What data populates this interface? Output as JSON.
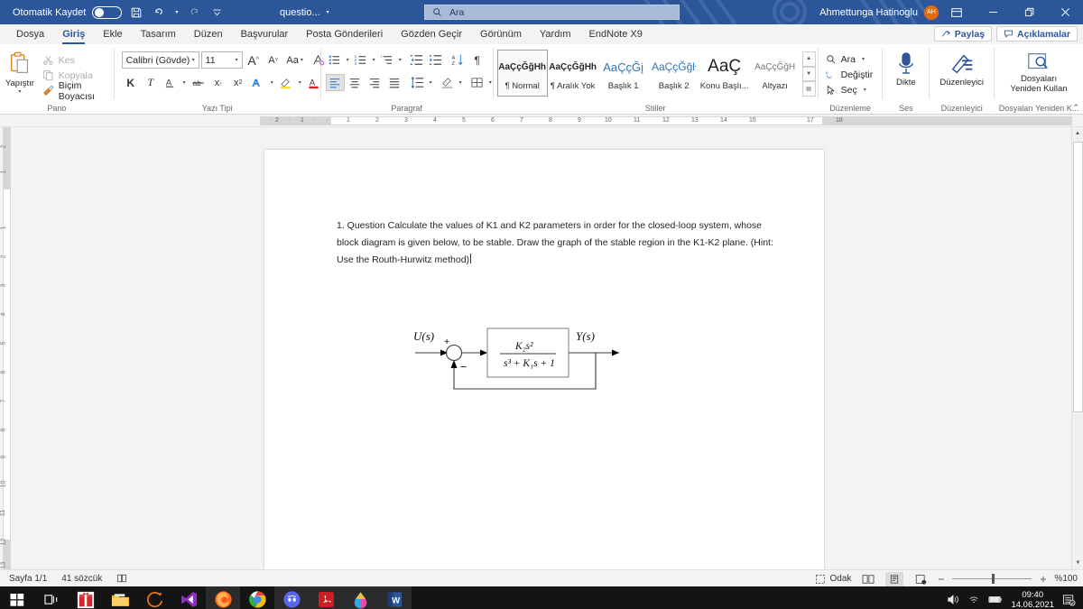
{
  "titlebar": {
    "autosave_label": "Otomatik Kaydet",
    "autosave_state": "off",
    "save_icon": "save-icon",
    "undo_icon": "undo-icon",
    "redo_icon": "redo-icon",
    "customize_icon": "customize-quick-access-icon",
    "document_name": "questio...",
    "search_placeholder": "Ara",
    "search_icon": "search-icon",
    "user_name": "Ahmettunga Hatinoglu",
    "user_initials": "AH",
    "ribbon_display_icon": "ribbon-display-options-icon",
    "minimize_icon": "minimize-icon",
    "restore_icon": "restore-icon",
    "close_icon": "close-icon"
  },
  "tabs": [
    {
      "label": "Dosya",
      "active": false
    },
    {
      "label": "Giriş",
      "active": true
    },
    {
      "label": "Ekle",
      "active": false
    },
    {
      "label": "Tasarım",
      "active": false
    },
    {
      "label": "Düzen",
      "active": false
    },
    {
      "label": "Başvurular",
      "active": false
    },
    {
      "label": "Posta Gönderileri",
      "active": false
    },
    {
      "label": "Gözden Geçir",
      "active": false
    },
    {
      "label": "Görünüm",
      "active": false
    },
    {
      "label": "Yardım",
      "active": false
    },
    {
      "label": "EndNote X9",
      "active": false
    }
  ],
  "tabstrip_right": {
    "share_label": "Paylaş",
    "share_icon": "share-icon",
    "comments_label": "Açıklamalar",
    "comments_icon": "comment-icon"
  },
  "ribbon": {
    "clipboard": {
      "group_label": "Pano",
      "paste_label": "Yapıştır",
      "paste_icon": "paste-icon",
      "cut_label": "Kes",
      "cut_icon": "scissors-icon",
      "copy_label": "Kopyala",
      "copy_icon": "copy-icon",
      "format_painter_label": "Biçim Boyacısı",
      "format_painter_icon": "format-painter-icon"
    },
    "font": {
      "group_label": "Yazı Tipi",
      "font_family": "Calibri (Gövde)",
      "font_size": "11",
      "grow_font_icon": "grow-font-icon",
      "shrink_font_icon": "shrink-font-icon",
      "change_case_label": "Aa",
      "clear_formatting_icon": "clear-formatting-icon",
      "bold_label": "K",
      "italic_label": "T",
      "underline_label": "A",
      "strikethrough_icon": "strikethrough-icon",
      "subscript_label": "x₂",
      "superscript_label": "x²",
      "text_effects_icon": "text-effects-icon",
      "highlight_icon": "highlight-color-icon",
      "font_color_icon": "font-color-icon"
    },
    "paragraph": {
      "group_label": "Paragraf",
      "bullets_icon": "bullet-list-icon",
      "numbering_icon": "numbered-list-icon",
      "multilevel_icon": "multilevel-list-icon",
      "decrease_indent_icon": "decrease-indent-icon",
      "increase_indent_icon": "increase-indent-icon",
      "sort_icon": "sort-icon",
      "show_marks_icon": "paragraph-marks-icon",
      "align_left_icon": "align-left-icon",
      "align_center_icon": "align-center-icon",
      "align_right_icon": "align-right-icon",
      "align_justify_icon": "align-justify-icon",
      "line_spacing_icon": "line-spacing-icon",
      "shading_icon": "shading-icon",
      "borders_icon": "borders-icon"
    },
    "styles": {
      "group_label": "Stiller",
      "items": [
        {
          "preview": "AaÇçĞğHh",
          "name": "¶ Normal",
          "selected": true
        },
        {
          "preview": "AaÇçĞğHh",
          "name": "¶ Aralık Yok",
          "selected": false
        },
        {
          "preview": "AaÇçĞį",
          "name": "Başlık 1",
          "selected": false
        },
        {
          "preview": "AaÇçĞğŀ",
          "name": "Başlık 2",
          "selected": false
        },
        {
          "preview": "AaÇ",
          "name": "Konu Başlı...",
          "selected": false
        },
        {
          "preview": "AaÇçĞğH",
          "name": "Altyazı",
          "selected": false
        }
      ],
      "scroll_up_icon": "scroll-up-icon",
      "scroll_down_icon": "scroll-down-icon",
      "more_styles_icon": "more-styles-icon"
    },
    "editing": {
      "group_label": "Düzenleme",
      "find_label": "Ara",
      "find_icon": "search-icon",
      "replace_label": "Değiştir",
      "replace_icon": "replace-icon",
      "select_label": "Seç",
      "select_icon": "select-cursor-icon"
    },
    "voice": {
      "group_label": "Ses",
      "dictate_label": "Dikte",
      "dictate_icon": "microphone-icon"
    },
    "editor": {
      "group_label": "Düzenleyici",
      "editor_label": "Düzenleyici",
      "editor_icon": "editor-pen-icon"
    },
    "reuse": {
      "group_label": "Dosyaları Yeniden K...",
      "reuse_label_1": "Dosyaları",
      "reuse_label_2": "Yeniden Kullan",
      "reuse_icon": "reuse-files-icon"
    },
    "collapse_icon": "collapse-ribbon-icon"
  },
  "ruler": {
    "horizontal_ticks": [
      "2",
      "1",
      "1",
      "2",
      "3",
      "4",
      "5",
      "6",
      "7",
      "8",
      "9",
      "10",
      "11",
      "12",
      "13",
      "14",
      "15",
      "17",
      "18"
    ],
    "vertical_ticks": [
      "2",
      "1",
      "1",
      "2",
      "3",
      "4",
      "5",
      "6",
      "7",
      "8",
      "9",
      "10",
      "11",
      "12",
      "13"
    ]
  },
  "document": {
    "paragraph_line_1": "1. Question Calculate the values of K1 and K2 parameters in order for the closed-loop system, whose",
    "paragraph_line_2": "block diagram is given below, to be stable. Draw the graph of the stable region in the K1-K2 plane.",
    "paragraph_line_3": "(Hint: Use the Routh-Hurwitz method)",
    "diagram": {
      "name": "control-system-block-diagram",
      "input_label": "U(s)",
      "output_label": "Y(s)",
      "plus_sign": "+",
      "minus_sign": "−",
      "numerator": "K₂s²",
      "denominator": "s³ + K₁s + 1"
    }
  },
  "statusbar": {
    "page_label": "Sayfa 1/1",
    "word_count": "41 sözcük",
    "proofing_icon": "proofing-icon",
    "focus_label": "Odak",
    "focus_icon": "focus-icon",
    "read_mode_icon": "read-mode-icon",
    "print_layout_icon": "print-layout-icon",
    "web_layout_icon": "web-layout-icon",
    "zoom_out_label": "−",
    "zoom_in_label": "+",
    "zoom_level": "%100"
  },
  "taskbar": {
    "items": [
      {
        "name": "start-button",
        "icon": "windows-logo-icon",
        "running": false
      },
      {
        "name": "task-view-button",
        "icon": "task-view-icon",
        "running": false
      },
      {
        "name": "taskbar-gift-app",
        "icon": "gift-icon",
        "running": false
      },
      {
        "name": "taskbar-file-explorer",
        "icon": "folder-icon",
        "running": false
      },
      {
        "name": "taskbar-arc-app",
        "icon": "arc-icon",
        "running": false
      },
      {
        "name": "taskbar-visual-studio",
        "icon": "visual-studio-icon",
        "running": false
      },
      {
        "name": "taskbar-firefox",
        "icon": "firefox-icon",
        "running": true
      },
      {
        "name": "taskbar-chrome",
        "icon": "chrome-icon",
        "running": false
      },
      {
        "name": "taskbar-discord",
        "icon": "discord-icon",
        "running": true
      },
      {
        "name": "taskbar-adobe-reader",
        "icon": "adobe-acrobat-icon",
        "running": true
      },
      {
        "name": "taskbar-paint-app",
        "icon": "paint-drop-icon",
        "running": true
      },
      {
        "name": "taskbar-word",
        "icon": "word-icon",
        "running": true
      }
    ],
    "tray": {
      "volume_icon": "volume-icon",
      "network_icon": "wifi-icon",
      "battery_icon": "battery-icon",
      "time": "09:40",
      "date": "14.06.2021",
      "notifications_icon": "notifications-icon"
    }
  }
}
